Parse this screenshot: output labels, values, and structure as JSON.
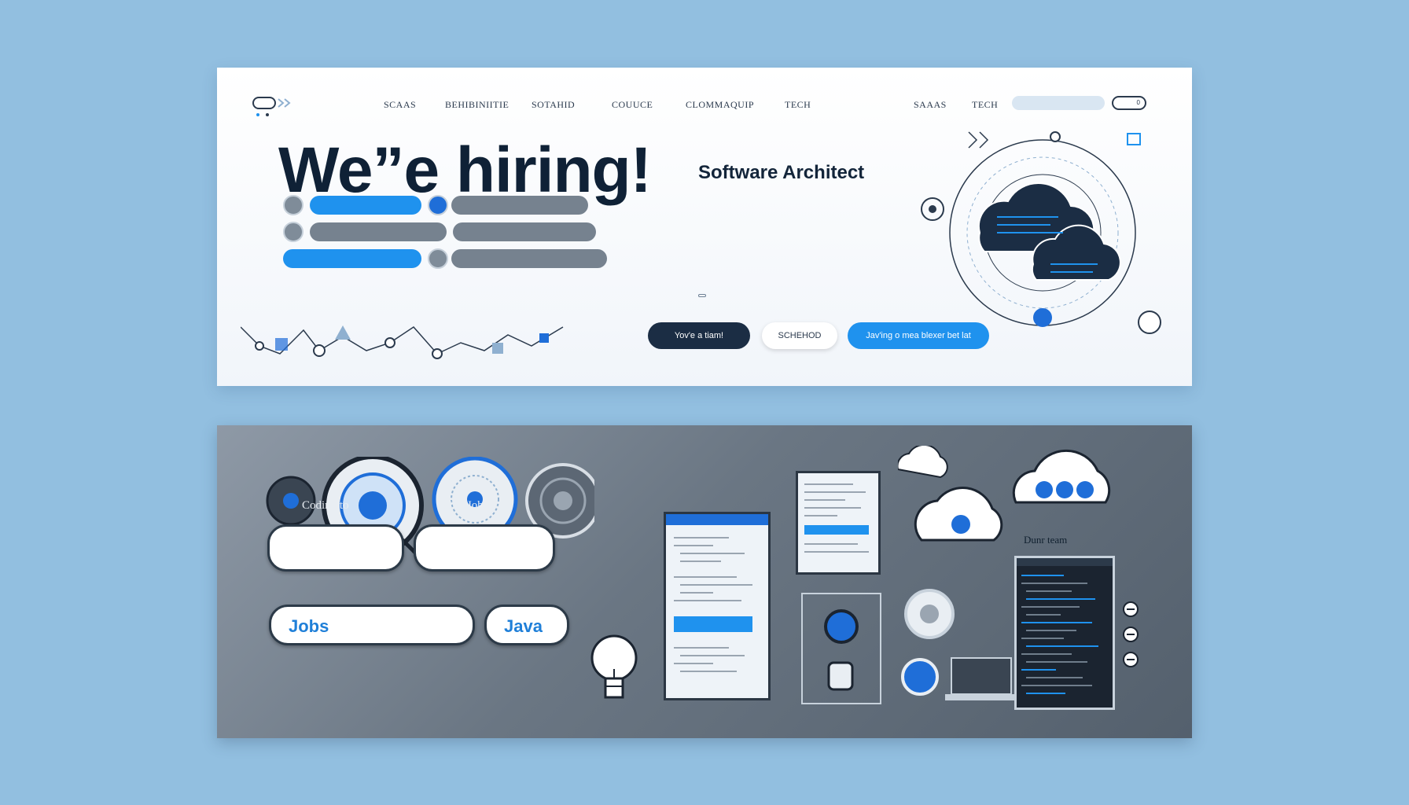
{
  "nav": {
    "items": [
      "SCAAS",
      "BEHIBINIITIE",
      "SOTAHID",
      "COUUCE",
      "CLOMMAQUIP",
      "TECH",
      "SAAAS",
      "TECH"
    ],
    "search_placeholder": "",
    "toggle_label": "0"
  },
  "hero": {
    "headline": "We”e hiring!",
    "role_title": "Software Architect",
    "description_1": "",
    "description_2": "",
    "tag_label": ""
  },
  "skills": [
    {
      "label": "",
      "style": "blue"
    },
    {
      "label": "",
      "style": "grey"
    },
    {
      "label": "",
      "style": "grey"
    },
    {
      "label": "",
      "style": "grey"
    },
    {
      "label": "",
      "style": "blue"
    },
    {
      "label": "",
      "style": "grey"
    }
  ],
  "cta": {
    "primary": "Yov'e a tiam!",
    "secondary": "SCHEHOD",
    "tertiary": "Jav'ing o mea blexer bet lat"
  },
  "bottom": {
    "label_coding": "Coding to",
    "label_jobs": "voing Jobos",
    "card_1_text": "",
    "card_2_text": "",
    "caption_1": "",
    "caption_2": "",
    "word_jobs": "Jobs",
    "word_java": "Java",
    "team_label": "Dunr team",
    "jobs_caption": ""
  },
  "colors": {
    "page_bg": "#92bfe0",
    "accent": "#1f92ee",
    "dark": "#1b2d44",
    "panel_dark": "#6a7683"
  }
}
